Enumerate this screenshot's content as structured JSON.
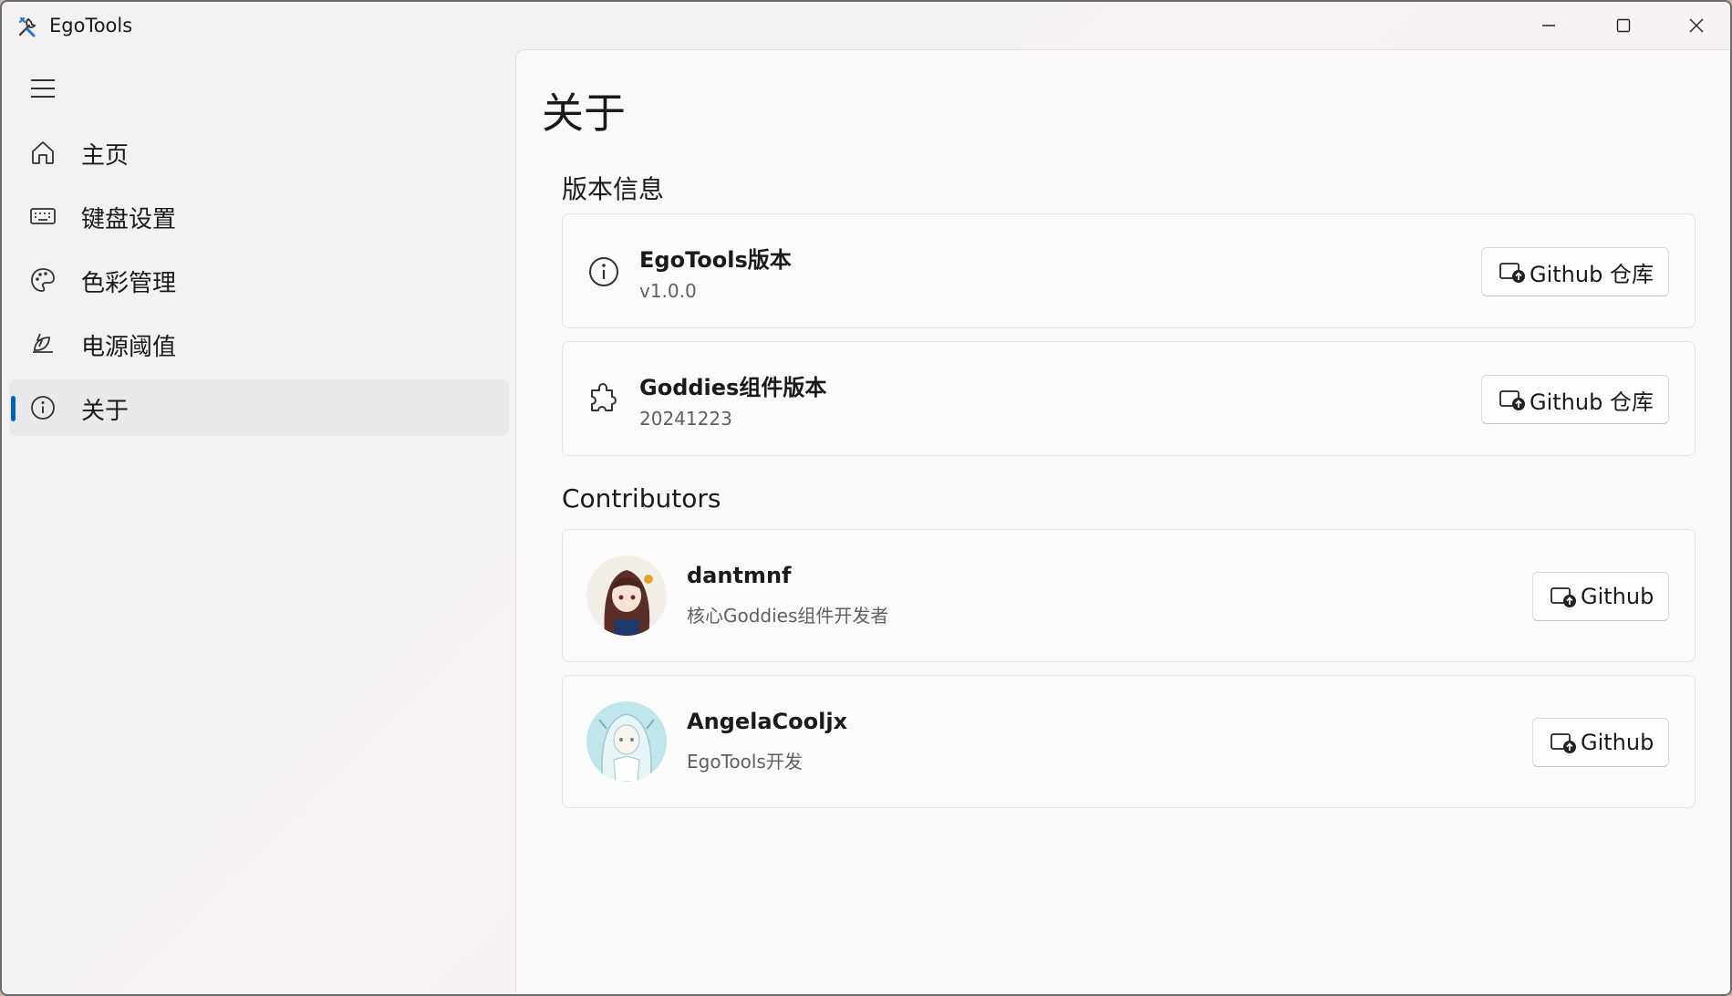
{
  "window": {
    "title": "EgoTools"
  },
  "sidebar": {
    "items": [
      {
        "label": "主页",
        "icon": "home-icon"
      },
      {
        "label": "键盘设置",
        "icon": "keyboard-icon"
      },
      {
        "label": "色彩管理",
        "icon": "palette-icon"
      },
      {
        "label": "电源阈值",
        "icon": "power-leaf-icon"
      },
      {
        "label": "关于",
        "icon": "info-icon",
        "active": true
      }
    ]
  },
  "page": {
    "title": "关于"
  },
  "version_section": {
    "title": "版本信息",
    "cards": [
      {
        "title": "EgoTools版本",
        "subtitle": "v1.0.0",
        "icon": "info-icon",
        "button": "Github 仓库"
      },
      {
        "title": "Goddies组件版本",
        "subtitle": "20241223",
        "icon": "puzzle-icon",
        "button": "Github 仓库"
      }
    ]
  },
  "contributors_section": {
    "title": "Contributors",
    "people": [
      {
        "name": "dantmnf",
        "role": "核心Goddies组件开发者",
        "button": "Github"
      },
      {
        "name": "AngelaCooljx",
        "role": "EgoTools开发",
        "button": "Github"
      }
    ]
  },
  "colors": {
    "accent": "#0067c0",
    "active_nav_bg": "#ebe8ec"
  }
}
